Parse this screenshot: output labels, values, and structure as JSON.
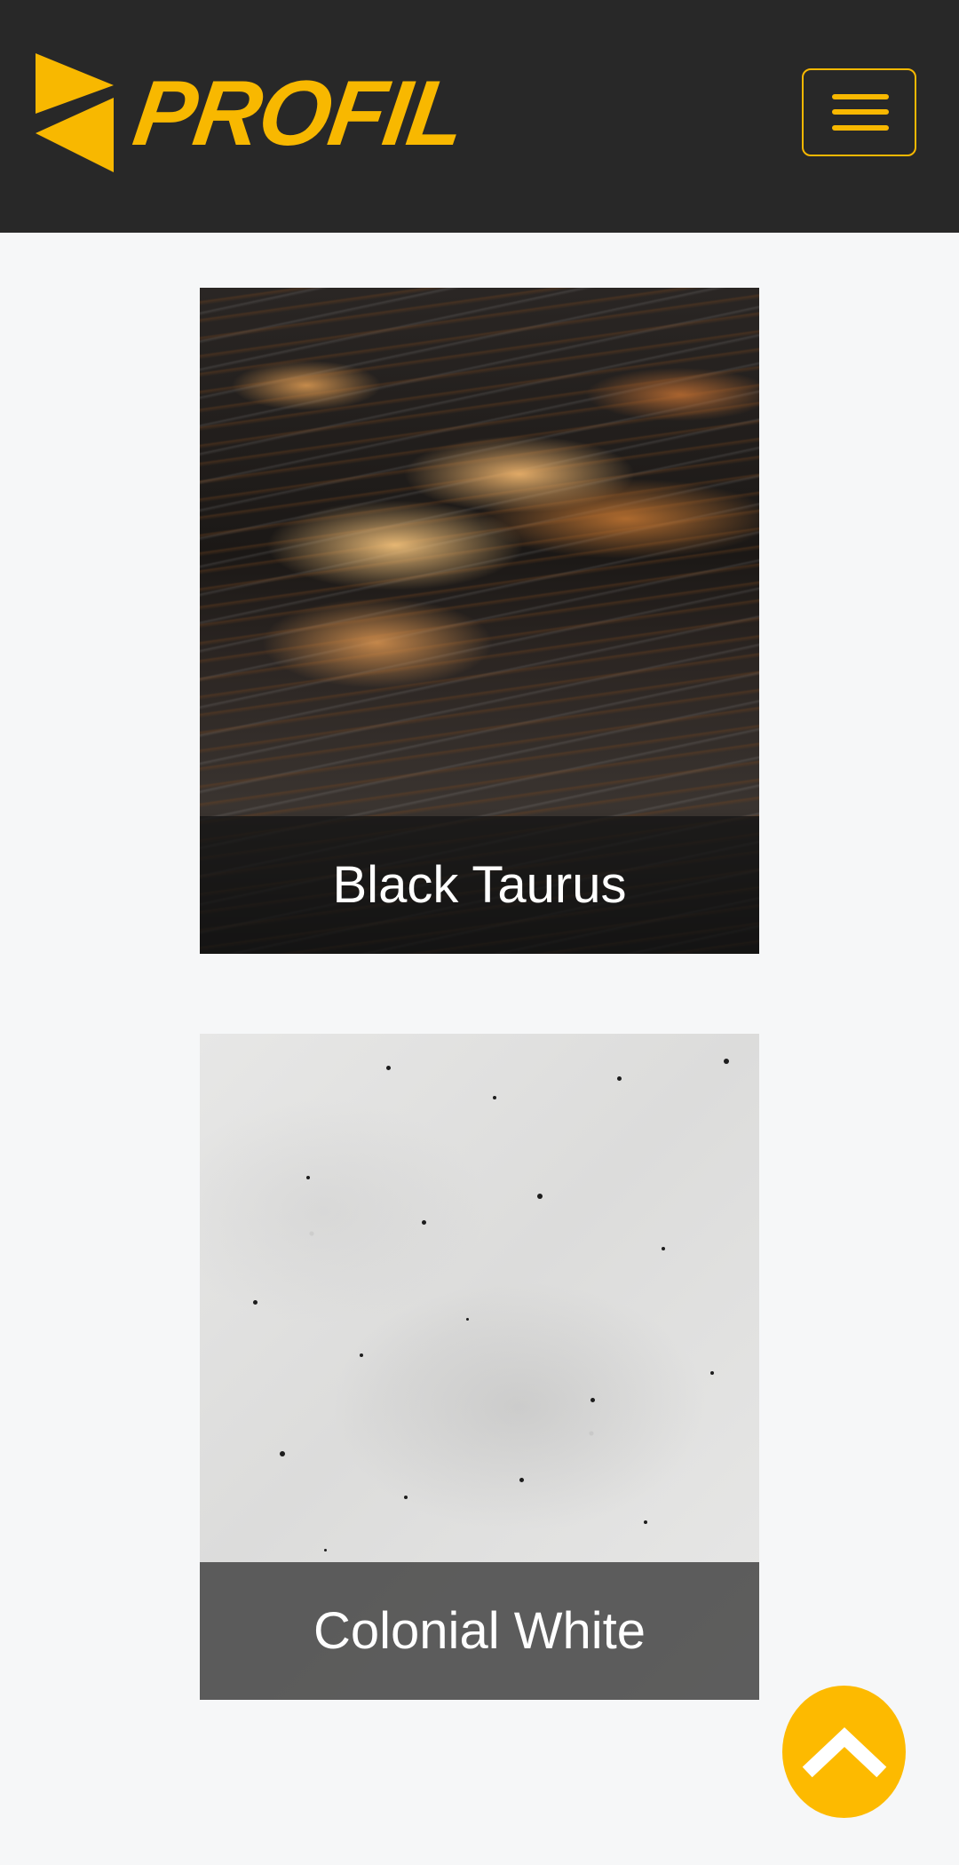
{
  "header": {
    "logo_text": "PROFIL",
    "brand_color": "#f8b800",
    "background": "#282828",
    "menu_icon": "hamburger-icon"
  },
  "products": [
    {
      "name": "Black Taurus"
    },
    {
      "name": "Colonial White"
    }
  ],
  "scroll_top": {
    "icon": "chevron-up-icon",
    "color": "#fdba00"
  }
}
